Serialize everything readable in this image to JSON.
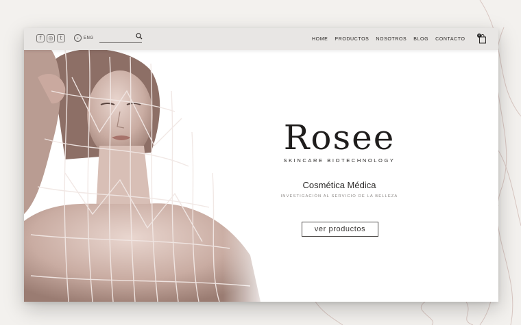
{
  "header": {
    "social": [
      {
        "icon": "facebook-icon",
        "glyph": "f"
      },
      {
        "icon": "instagram-icon",
        "glyph": "◎"
      },
      {
        "icon": "twitter-icon",
        "glyph": "t"
      }
    ],
    "language_label": "ENG",
    "search_placeholder": "",
    "nav": [
      "HOME",
      "PRODUCTOS",
      "NOSOTROS",
      "BLOG",
      "CONTACTO"
    ],
    "cart_count": "0"
  },
  "hero": {
    "brand": "Rosee",
    "tagline": "SKINCARE BIOTECHNOLOGY",
    "headline": "Cosmética Médica",
    "subheadline": "INVESTIGACIÓN AL SERVICIO DE LA BELLEZA",
    "cta_label": "ver productos"
  },
  "colors": {
    "background": "#f3f1ee",
    "header": "#e8e6e4",
    "text": "#1f1d1c",
    "accent_lines": "#c9b1ab"
  }
}
